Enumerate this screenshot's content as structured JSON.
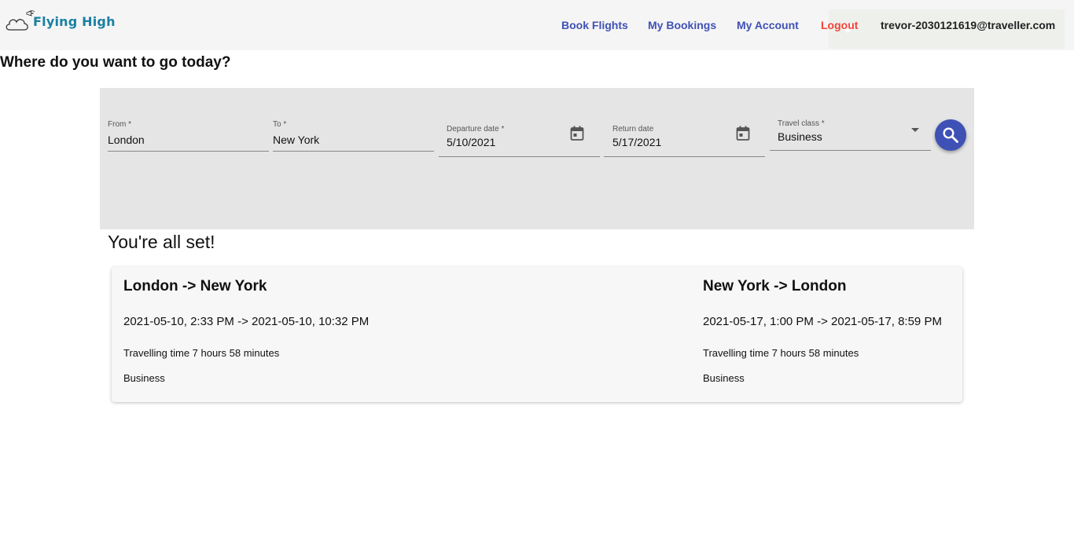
{
  "brand": {
    "name": "Flying High",
    "logo_icon": "cloud-plane-logo",
    "color": "#1a7fa3"
  },
  "nav": {
    "book_flights": "Book Flights",
    "my_bookings": "My Bookings",
    "my_account": "My Account",
    "logout": "Logout",
    "user_email": "trevor-2030121619@traveller.com",
    "link_color": "#3f51b5",
    "logout_color": "#f44336"
  },
  "page": {
    "heading": "Where do you want to go today?"
  },
  "search": {
    "from": {
      "label": "From *",
      "value": "London"
    },
    "to": {
      "label": "To *",
      "value": "New York"
    },
    "departure": {
      "label": "Departure date *",
      "value": "5/10/2021",
      "icon": "calendar-icon"
    },
    "return": {
      "label": "Return date",
      "value": "5/17/2021",
      "icon": "calendar-icon"
    },
    "travel_class": {
      "label": "Travel class *",
      "value": "Business",
      "icon": "dropdown-arrow-icon"
    },
    "button_icon": "search-icon",
    "button_color": "#3f51b5"
  },
  "confirmation": {
    "title": "You're all set!",
    "outbound": {
      "route": "London -> New York",
      "times": "2021-05-10, 2:33 PM -> 2021-05-10, 10:32 PM",
      "duration": "Travelling time 7 hours 58 minutes",
      "class": "Business"
    },
    "inbound": {
      "route": "New York -> London",
      "times": "2021-05-17, 1:00 PM -> 2021-05-17, 8:59 PM",
      "duration": "Travelling time 7 hours 58 minutes",
      "class": "Business"
    }
  }
}
